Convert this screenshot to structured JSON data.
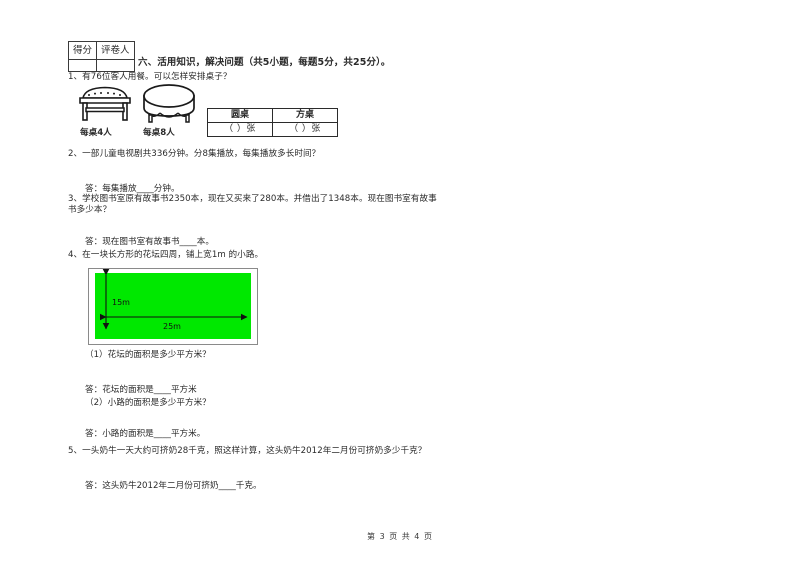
{
  "score_table": {
    "headers": [
      "得分",
      "评卷人"
    ],
    "values": [
      "",
      ""
    ]
  },
  "section": {
    "title": "六、活用知识，解决问题（共5小题，每题5分，共25分）。"
  },
  "questions": [
    {
      "number": "1",
      "text": "1、有76位客人用餐。可以怎样安排桌子？",
      "figures": [
        {
          "icon": "square-table-icon",
          "caption": "每桌4人"
        },
        {
          "icon": "round-table-icon",
          "caption": "每桌8人"
        }
      ],
      "table": {
        "headers": [
          "圆桌",
          "方桌"
        ],
        "cells": [
          "（    ）张",
          "（    ）张"
        ]
      }
    },
    {
      "number": "2",
      "text": "2、一部儿童电视剧共336分钟。分8集播放，每集播放多长时间？",
      "answer": "答：每集播放____分钟。"
    },
    {
      "number": "3",
      "text_line1": "3、学校图书室原有故事书2350本，现在又买来了280本。并借出了1348本。现在图书室有故事",
      "text_line2": "书多少本？",
      "answer": "答：现在图书室有故事书____本。"
    },
    {
      "number": "4",
      "text": "4、在一块长方形的花坛四周，铺上宽1m 的小路。",
      "diagram": {
        "height_label": "15m",
        "width_label": "25m",
        "fill_color": "#00e800"
      },
      "sub": [
        {
          "prompt": "（1）花坛的面积是多少平方米？",
          "answer": "答：花坛的面积是____平方米"
        },
        {
          "prompt": "（2）小路的面积是多少平方米？",
          "answer": "答：小路的面积是____平方米。"
        }
      ]
    },
    {
      "number": "5",
      "text": "5、一头奶牛一天大约可挤奶28千克，照这样计算，这头奶牛2012年二月份可挤奶多少千克？",
      "answer": "答：这头奶牛2012年二月份可挤奶____千克。"
    }
  ],
  "footer": {
    "text": "第 3 页 共 4 页"
  }
}
